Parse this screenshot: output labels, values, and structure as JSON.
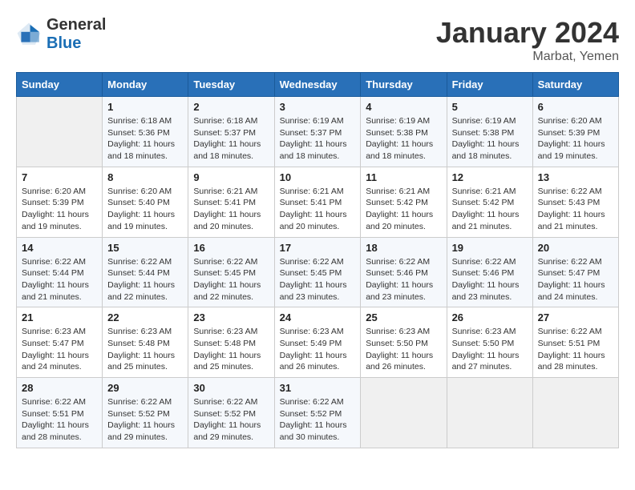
{
  "header": {
    "logo_general": "General",
    "logo_blue": "Blue",
    "title": "January 2024",
    "location": "Marbat, Yemen"
  },
  "days_of_week": [
    "Sunday",
    "Monday",
    "Tuesday",
    "Wednesday",
    "Thursday",
    "Friday",
    "Saturday"
  ],
  "weeks": [
    [
      {
        "day": null
      },
      {
        "day": "1",
        "sunrise": "6:18 AM",
        "sunset": "5:36 PM",
        "daylight": "11 hours and 18 minutes."
      },
      {
        "day": "2",
        "sunrise": "6:18 AM",
        "sunset": "5:37 PM",
        "daylight": "11 hours and 18 minutes."
      },
      {
        "day": "3",
        "sunrise": "6:19 AM",
        "sunset": "5:37 PM",
        "daylight": "11 hours and 18 minutes."
      },
      {
        "day": "4",
        "sunrise": "6:19 AM",
        "sunset": "5:38 PM",
        "daylight": "11 hours and 18 minutes."
      },
      {
        "day": "5",
        "sunrise": "6:19 AM",
        "sunset": "5:38 PM",
        "daylight": "11 hours and 18 minutes."
      },
      {
        "day": "6",
        "sunrise": "6:20 AM",
        "sunset": "5:39 PM",
        "daylight": "11 hours and 19 minutes."
      }
    ],
    [
      {
        "day": "7",
        "sunrise": "6:20 AM",
        "sunset": "5:39 PM",
        "daylight": "11 hours and 19 minutes."
      },
      {
        "day": "8",
        "sunrise": "6:20 AM",
        "sunset": "5:40 PM",
        "daylight": "11 hours and 19 minutes."
      },
      {
        "day": "9",
        "sunrise": "6:21 AM",
        "sunset": "5:41 PM",
        "daylight": "11 hours and 20 minutes."
      },
      {
        "day": "10",
        "sunrise": "6:21 AM",
        "sunset": "5:41 PM",
        "daylight": "11 hours and 20 minutes."
      },
      {
        "day": "11",
        "sunrise": "6:21 AM",
        "sunset": "5:42 PM",
        "daylight": "11 hours and 20 minutes."
      },
      {
        "day": "12",
        "sunrise": "6:21 AM",
        "sunset": "5:42 PM",
        "daylight": "11 hours and 21 minutes."
      },
      {
        "day": "13",
        "sunrise": "6:22 AM",
        "sunset": "5:43 PM",
        "daylight": "11 hours and 21 minutes."
      }
    ],
    [
      {
        "day": "14",
        "sunrise": "6:22 AM",
        "sunset": "5:44 PM",
        "daylight": "11 hours and 21 minutes."
      },
      {
        "day": "15",
        "sunrise": "6:22 AM",
        "sunset": "5:44 PM",
        "daylight": "11 hours and 22 minutes."
      },
      {
        "day": "16",
        "sunrise": "6:22 AM",
        "sunset": "5:45 PM",
        "daylight": "11 hours and 22 minutes."
      },
      {
        "day": "17",
        "sunrise": "6:22 AM",
        "sunset": "5:45 PM",
        "daylight": "11 hours and 23 minutes."
      },
      {
        "day": "18",
        "sunrise": "6:22 AM",
        "sunset": "5:46 PM",
        "daylight": "11 hours and 23 minutes."
      },
      {
        "day": "19",
        "sunrise": "6:22 AM",
        "sunset": "5:46 PM",
        "daylight": "11 hours and 23 minutes."
      },
      {
        "day": "20",
        "sunrise": "6:22 AM",
        "sunset": "5:47 PM",
        "daylight": "11 hours and 24 minutes."
      }
    ],
    [
      {
        "day": "21",
        "sunrise": "6:23 AM",
        "sunset": "5:47 PM",
        "daylight": "11 hours and 24 minutes."
      },
      {
        "day": "22",
        "sunrise": "6:23 AM",
        "sunset": "5:48 PM",
        "daylight": "11 hours and 25 minutes."
      },
      {
        "day": "23",
        "sunrise": "6:23 AM",
        "sunset": "5:48 PM",
        "daylight": "11 hours and 25 minutes."
      },
      {
        "day": "24",
        "sunrise": "6:23 AM",
        "sunset": "5:49 PM",
        "daylight": "11 hours and 26 minutes."
      },
      {
        "day": "25",
        "sunrise": "6:23 AM",
        "sunset": "5:50 PM",
        "daylight": "11 hours and 26 minutes."
      },
      {
        "day": "26",
        "sunrise": "6:23 AM",
        "sunset": "5:50 PM",
        "daylight": "11 hours and 27 minutes."
      },
      {
        "day": "27",
        "sunrise": "6:22 AM",
        "sunset": "5:51 PM",
        "daylight": "11 hours and 28 minutes."
      }
    ],
    [
      {
        "day": "28",
        "sunrise": "6:22 AM",
        "sunset": "5:51 PM",
        "daylight": "11 hours and 28 minutes."
      },
      {
        "day": "29",
        "sunrise": "6:22 AM",
        "sunset": "5:52 PM",
        "daylight": "11 hours and 29 minutes."
      },
      {
        "day": "30",
        "sunrise": "6:22 AM",
        "sunset": "5:52 PM",
        "daylight": "11 hours and 29 minutes."
      },
      {
        "day": "31",
        "sunrise": "6:22 AM",
        "sunset": "5:52 PM",
        "daylight": "11 hours and 30 minutes."
      },
      {
        "day": null
      },
      {
        "day": null
      },
      {
        "day": null
      }
    ]
  ]
}
